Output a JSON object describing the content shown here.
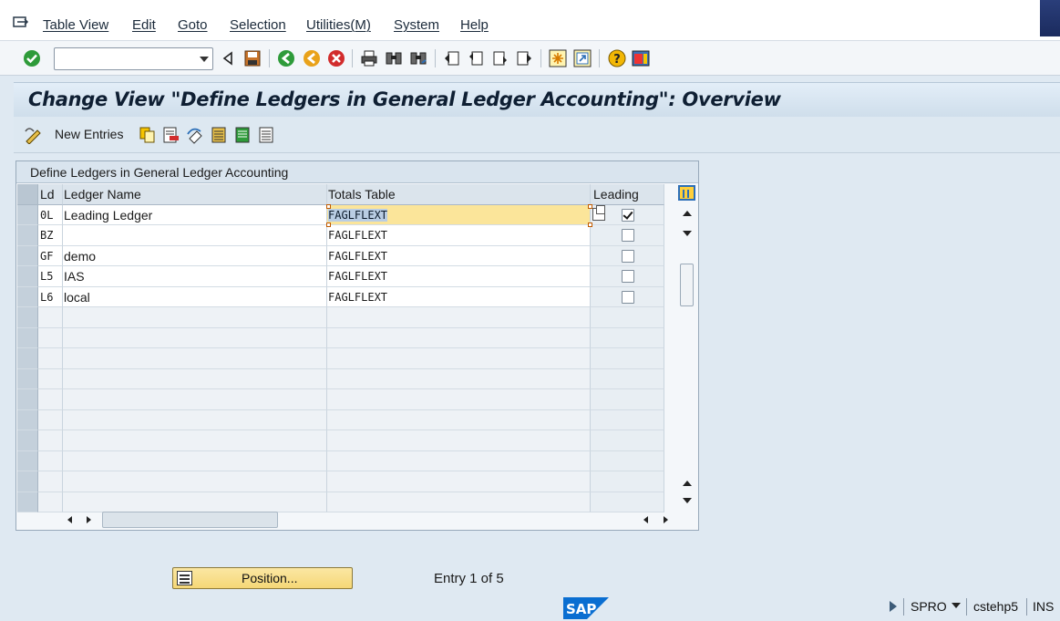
{
  "menubar": {
    "items": [
      "Table View",
      "Edit",
      "Goto",
      "Selection",
      "Utilities(M)",
      "System",
      "Help"
    ]
  },
  "systoolbar": {
    "command_field_value": "",
    "icons": [
      "enter-icon",
      "back-icon",
      "save-icon",
      "back-green-icon",
      "exit-icon",
      "cancel-icon",
      "print-icon",
      "find-icon",
      "find-next-icon",
      "first-page-icon",
      "previous-page-icon",
      "next-page-icon",
      "last-page-icon",
      "create-session-icon",
      "shortcut-icon",
      "help-icon",
      "layout-icon"
    ]
  },
  "title": "Change View \"Define Ledgers in General Ledger Accounting\": Overview",
  "apptoolbar": {
    "new_entries_label": "New Entries"
  },
  "table": {
    "title": "Define Ledgers in General Ledger Accounting",
    "columns": {
      "ld": "Ld",
      "name": "Ledger Name",
      "totals": "Totals Table",
      "leading": "Leading"
    },
    "rows": [
      {
        "ld": "0L",
        "name": "Leading Ledger",
        "totals": "FAGLFLEXT",
        "leading": true
      },
      {
        "ld": "BZ",
        "name": "",
        "totals": "FAGLFLEXT",
        "leading": false
      },
      {
        "ld": "GF",
        "name": "demo",
        "totals": "FAGLFLEXT",
        "leading": false
      },
      {
        "ld": "L5",
        "name": "IAS",
        "totals": "FAGLFLEXT",
        "leading": false
      },
      {
        "ld": "L6",
        "name": "local",
        "totals": "FAGLFLEXT",
        "leading": false
      }
    ]
  },
  "footer": {
    "position_button": "Position...",
    "entry_text": "Entry 1 of 5"
  },
  "statusbar": {
    "logo_text": "SAP",
    "transaction": "SPRO",
    "system": "cstehp5",
    "mode": "INS"
  },
  "colors": {
    "background": "#dfe9f2",
    "focus_cell": "#fbe59a",
    "position_button": "#f5d776",
    "sap_blue": "#0a6ed1"
  }
}
